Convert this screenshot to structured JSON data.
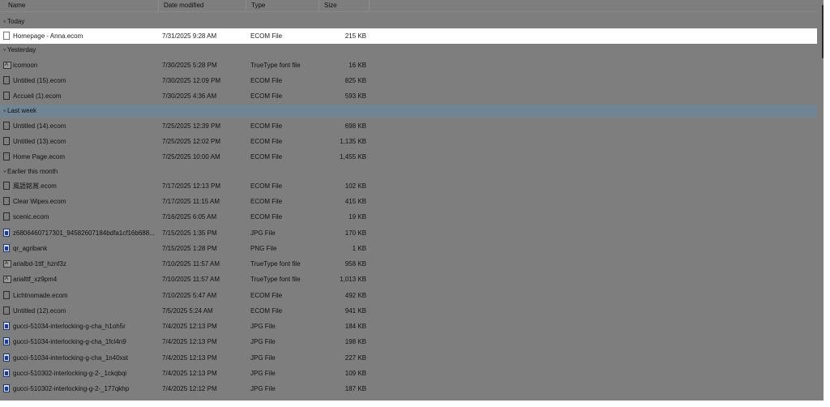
{
  "columns": {
    "name": "Name",
    "date_modified": "Date modified",
    "type": "Type",
    "size": "Size"
  },
  "groups": {
    "today": "Today",
    "yesterday": "Yesterday",
    "last_week": "Last week",
    "earlier_this_month": "Earlier this month"
  },
  "rows": [
    {
      "name": "Homepage - Anna.ecom",
      "date": "7/31/2025 9:28 AM",
      "type": "ECOM File",
      "size": "215 KB",
      "icon": "document-icon"
    },
    {
      "name": "icomoon",
      "date": "7/30/2025 5:28 PM",
      "type": "TrueType font file",
      "size": "16 KB",
      "icon": "font-file-icon"
    },
    {
      "name": "Untitled (15).ecom",
      "date": "7/30/2025 12:09 PM",
      "type": "ECOM File",
      "size": "825 KB",
      "icon": "document-icon"
    },
    {
      "name": "Accueil (1).ecom",
      "date": "7/30/2025 4:36 AM",
      "type": "ECOM File",
      "size": "593 KB",
      "icon": "document-icon"
    },
    {
      "name": "Untitled (14).ecom",
      "date": "7/25/2025 12:39 PM",
      "type": "ECOM File",
      "size": "698 KB",
      "icon": "document-icon"
    },
    {
      "name": "Untitled (13).ecom",
      "date": "7/25/2025 12:02 PM",
      "type": "ECOM File",
      "size": "1,135 KB",
      "icon": "document-icon"
    },
    {
      "name": "Home Page.ecom",
      "date": "7/25/2025 10:00 AM",
      "type": "ECOM File",
      "size": "1,455 KB",
      "icon": "document-icon"
    },
    {
      "name": "風語銘賞.ecom",
      "date": "7/17/2025 12:13 PM",
      "type": "ECOM File",
      "size": "102 KB",
      "icon": "document-icon"
    },
    {
      "name": "Clear Wipes.ecom",
      "date": "7/17/2025 11:15 AM",
      "type": "ECOM File",
      "size": "415 KB",
      "icon": "document-icon"
    },
    {
      "name": "scenic.ecom",
      "date": "7/16/2025 6:05 AM",
      "type": "ECOM File",
      "size": "19 KB",
      "icon": "document-icon"
    },
    {
      "name": "z6806460717301_94582607184bdfa1cf16b688...",
      "date": "7/15/2025 1:35 PM",
      "type": "JPG File",
      "size": "170 KB",
      "icon": "image-file-icon"
    },
    {
      "name": "qr_agribank",
      "date": "7/15/2025 1:28 PM",
      "type": "PNG File",
      "size": "1 KB",
      "icon": "image-file-icon"
    },
    {
      "name": "arialbd-1ttf_hznf3z",
      "date": "7/10/2025 11:57 AM",
      "type": "TrueType font file",
      "size": "958 KB",
      "icon": "font-file-icon"
    },
    {
      "name": "arialttf_xz9pm4",
      "date": "7/10/2025 11:57 AM",
      "type": "TrueType font file",
      "size": "1,013 KB",
      "icon": "font-file-icon"
    },
    {
      "name": "Lichtnomade.ecom",
      "date": "7/10/2025 5:47 AM",
      "type": "ECOM File",
      "size": "492 KB",
      "icon": "document-icon"
    },
    {
      "name": "Untitled (12).ecom",
      "date": "7/5/2025 5:24 AM",
      "type": "ECOM File",
      "size": "941 KB",
      "icon": "document-icon"
    },
    {
      "name": "gucci-51034-interlocking-g-cha_h1oh5r",
      "date": "7/4/2025 12:13 PM",
      "type": "JPG File",
      "size": "184 KB",
      "icon": "image-file-icon"
    },
    {
      "name": "gucci-51034-interlocking-g-cha_1fcl4n9",
      "date": "7/4/2025 12:13 PM",
      "type": "JPG File",
      "size": "198 KB",
      "icon": "image-file-icon"
    },
    {
      "name": "gucci-51034-interlocking-g-cha_1n40xst",
      "date": "7/4/2025 12:13 PM",
      "type": "JPG File",
      "size": "227 KB",
      "icon": "image-file-icon"
    },
    {
      "name": "gucci-510302-interlocking-g-2-_1ckqbqi",
      "date": "7/4/2025 12:13 PM",
      "type": "JPG File",
      "size": "109 KB",
      "icon": "image-file-icon"
    },
    {
      "name": "gucci-510302-interlocking-g-2-_177qkhp",
      "date": "7/4/2025 12:12 PM",
      "type": "JPG File",
      "size": "187 KB",
      "icon": "image-file-icon"
    }
  ]
}
